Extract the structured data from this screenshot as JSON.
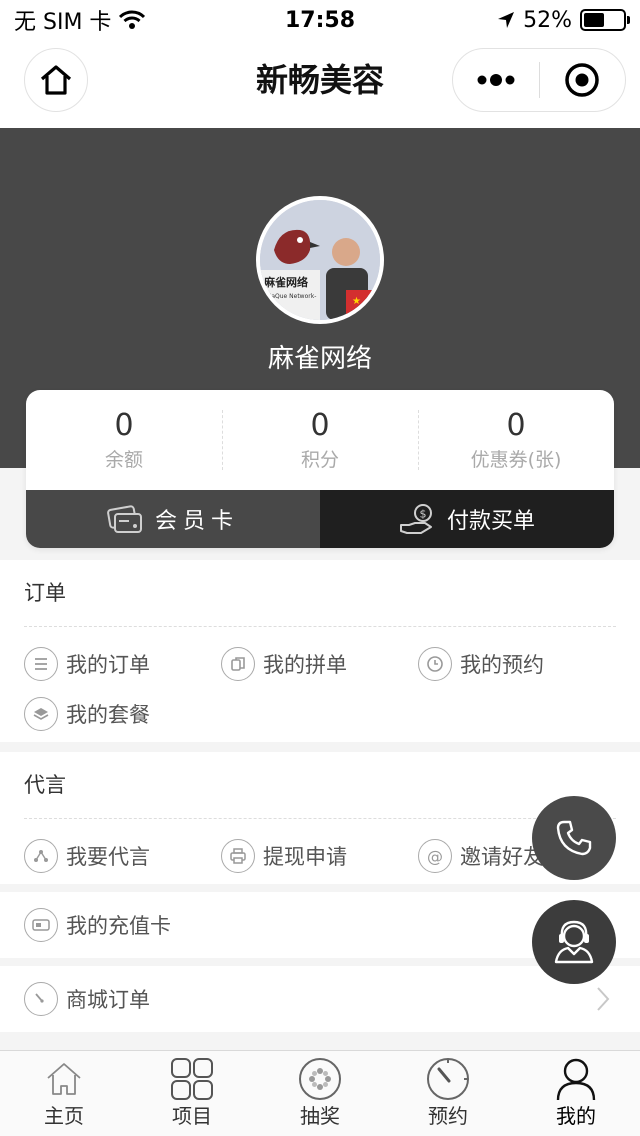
{
  "status_bar": {
    "carrier": "无 SIM 卡",
    "time": "17:58",
    "battery": "52%",
    "battery_level": 0.52
  },
  "nav": {
    "title": "新畅美容"
  },
  "profile": {
    "name": "麻雀网络",
    "avatar_text": "麻雀网络",
    "avatar_subtext": "-MaQue Network-"
  },
  "stats": [
    {
      "value": "0",
      "label": "余额"
    },
    {
      "value": "0",
      "label": "积分"
    },
    {
      "value": "0",
      "label": "优惠券(张)"
    }
  ],
  "card_buttons": {
    "member": "会员卡",
    "pay": "付款买单"
  },
  "orders": {
    "title": "订单",
    "items": [
      {
        "label": "我的订单",
        "icon": "list-icon"
      },
      {
        "label": "我的拼单",
        "icon": "copy-icon"
      },
      {
        "label": "我的预约",
        "icon": "clock-icon"
      },
      {
        "label": "我的套餐",
        "icon": "layers-icon"
      }
    ]
  },
  "endorse": {
    "title": "代言",
    "items": [
      {
        "label": "我要代言",
        "icon": "share-icon"
      },
      {
        "label": "提现申请",
        "icon": "printer-icon"
      },
      {
        "label": "邀请好友",
        "icon": "at-icon"
      }
    ]
  },
  "rows": [
    {
      "label": "我的充值卡",
      "icon": "card-icon"
    },
    {
      "label": "商城订单",
      "icon": "gauge-icon"
    }
  ],
  "tabs": [
    {
      "label": "主页",
      "icon": "home-icon"
    },
    {
      "label": "项目",
      "icon": "grid-icon"
    },
    {
      "label": "抽奖",
      "icon": "lottery-icon"
    },
    {
      "label": "预约",
      "icon": "timer-icon"
    },
    {
      "label": "我的",
      "icon": "user-icon"
    }
  ],
  "colors": {
    "header_bg": "#484848",
    "pay_bg": "#1f1f1f",
    "float_bg": "#4a4a4a"
  }
}
